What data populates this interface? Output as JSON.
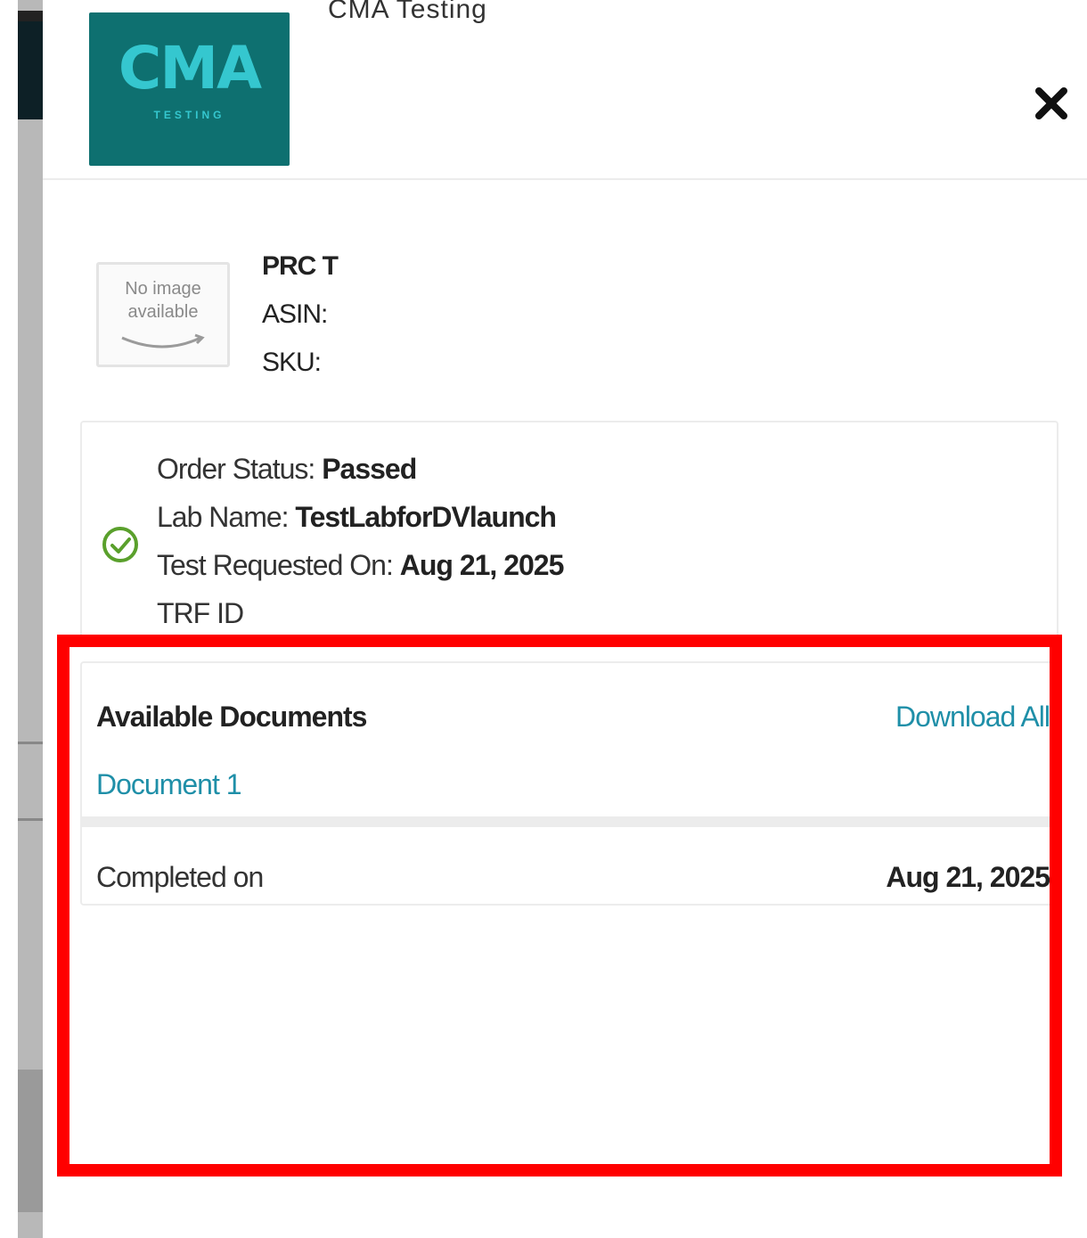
{
  "header": {
    "title": "CMA Testing",
    "logo_text": "CMA",
    "logo_subtext": "TESTING",
    "close_icon": "close-icon"
  },
  "product": {
    "image_placeholder": "No image available",
    "name_label": "PRC T",
    "asin_label": "ASIN:",
    "sku_label": "SKU:"
  },
  "status": {
    "icon": "check-circle-icon",
    "icon_color": "#5aa02c",
    "order_status_label": "Order Status:",
    "order_status_value": "Passed",
    "lab_name_label": "Lab Name:",
    "lab_name_value": "TestLabforDVlaunch",
    "requested_label": "Test Requested On:",
    "requested_value": "Aug 21, 2025",
    "trf_label": "TRF ID"
  },
  "documents": {
    "title": "Available Documents",
    "download_all_label": "Download All",
    "items": [
      {
        "label": "Document 1"
      }
    ],
    "completed_label": "Completed on",
    "completed_value": "Aug 21, 2025"
  },
  "colors": {
    "brand_teal": "#0e7070",
    "link": "#1f8fa8",
    "highlight": "#ff0000"
  }
}
